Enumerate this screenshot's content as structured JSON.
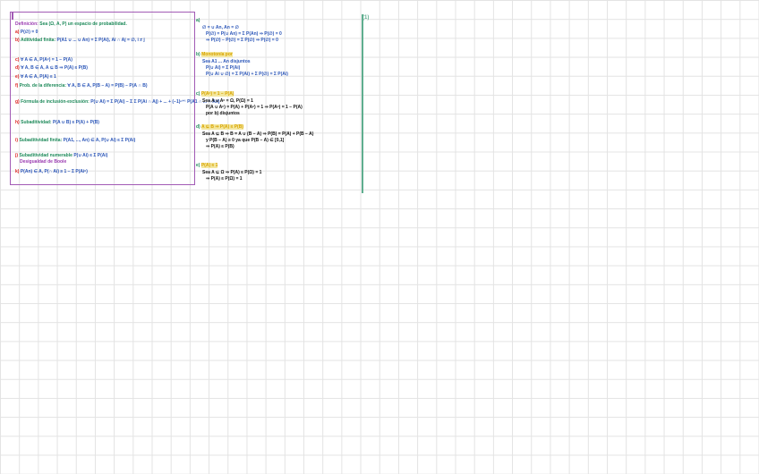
{
  "left_box": {
    "title": "Definición:",
    "intro": "Sea (Ω, A, P) un espacio de probabilidad.",
    "items": [
      {
        "label": "a)",
        "text": "P(∅) = 0"
      },
      {
        "label": "b)",
        "name": "Aditividad finita:",
        "text": "P(A1 ∪ ... ∪ An) = Σ P(Ai), Ai ∩ Aj = ∅, i ≠ j"
      },
      {
        "label": "c)",
        "text": "∀ A ∈ A, P(Aᶜ) = 1 − P(A)"
      },
      {
        "label": "d)",
        "text": "∀ A, B ∈ A, A ⊆ B ⇒ P(A) ≤ P(B)"
      },
      {
        "label": "e)",
        "text": "∀ A ∈ A, P(A) ≤ 1"
      },
      {
        "label": "f)",
        "name": "Prob. de la diferencia:",
        "text": "∀ A, B ∈ A, P(B − A) = P(B) − P(A ∩ B)"
      },
      {
        "label": "g)",
        "name": "Fórmula de inclusión-exclusión:",
        "text": "P(∪ Ai) = Σ P(Ai) − Σ Σ P(Ai ∩ Aj) + ... + (−1)ⁿ⁺¹ P(A1 ∩ ... ∩ An)"
      },
      {
        "label": "h)",
        "name": "Subaditividad:",
        "text": "P(A ∪ B) ≤ P(A) + P(B)"
      },
      {
        "label": "i)",
        "name": "Subaditividad finita:",
        "text": "P(A1, ..., An) ∈ A, P(∪ Ai) ≤ Σ P(Ai)"
      },
      {
        "label": "j)",
        "name": "Subaditividad numerable",
        "sub": "Desigualdad de Boole",
        "text": "P(∪ Ai) ≤ Σ P(Ai)"
      },
      {
        "label": "k)",
        "text": "P(An) ∈ A, P(∩ Ai) ≥ 1 − Σ P(Aiᶜ)"
      }
    ]
  },
  "middle": {
    "items": [
      {
        "label": "a)",
        "lines": [
          "∅ = ∪ An, An = ∅",
          "P(∅) = P(∪ An) = Σ P(An) ⇒ P(∅) = 0",
          "⇒ P(∅) − P(∅) = Σ P(∅) ⇒ P(∅) = 0"
        ]
      },
      {
        "label": "b)",
        "name": "Monotonía por",
        "lines": [
          "Sea A1 ... An disjuntos",
          "P(∪ Ai) = Σ P(Ai)",
          "P(∪ Ai ∪ ∅) = Σ P(Ai) + Σ P(∅) = Σ P(Ai)"
        ]
      },
      {
        "label": "c)",
        "name": "P(Aᶜ) = 1 − P(A)",
        "lines": [
          "Sea A ∪ Aᶜ = Ω, P(Ω) = 1",
          "P(A ∪ Aᶜ) = P(A) + P(Aᶜ) = 1 ⇒ P(Aᶜ) = 1 − P(A)",
          "por b) disjuntos"
        ]
      },
      {
        "label": "d)",
        "name": "A ⊆ B ⇒ P(A) ≤ P(B)",
        "lines": [
          "Sea A ⊆ B ⇒ B = A ∪ (B − A) ⇒ P(B) = P(A) + P(B − A)",
          "y P(B − A) ≥ 0 ya que P(B − A) ∈ [0,1]",
          "⇒ P(A) ≤ P(B)"
        ]
      },
      {
        "label": "e)",
        "name": "P(A) ≤ 1",
        "lines": [
          "Sea A ⊆ Ω ⇒ P(A) ≤ P(Ω) = 1",
          "⇒ P(A) ≤ P(Ω) = 1"
        ]
      }
    ]
  },
  "page_number": "(1)",
  "colors": {
    "box_border": "#a25bb5",
    "divider": "#5fae8f",
    "green": "#1e8a5a",
    "blue": "#2a55b8",
    "red": "#d22",
    "yellow": "#d9a400"
  }
}
